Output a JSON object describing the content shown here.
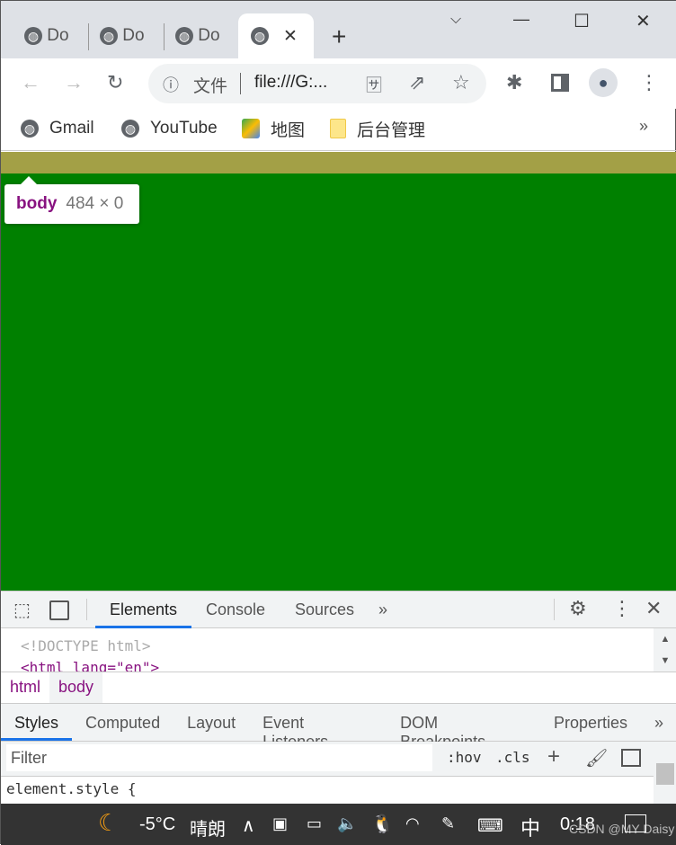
{
  "tabs": [
    {
      "title": "Do"
    },
    {
      "title": "Do"
    },
    {
      "title": "Do"
    },
    {
      "title": "",
      "active": true
    }
  ],
  "window": {
    "tab_search": "⌵",
    "minimize": "—",
    "maximize": "☐",
    "close": "✕",
    "new_tab": "+"
  },
  "address": {
    "security_label": "文件",
    "url": "file:///G:..."
  },
  "bookmarks": [
    {
      "label": "Gmail",
      "icon": "globe-icon"
    },
    {
      "label": "YouTube",
      "icon": "globe-icon"
    },
    {
      "label": "地图",
      "icon": "maps-icon"
    },
    {
      "label": "后台管理",
      "icon": "folder-icon"
    }
  ],
  "bookmarks_more": "»",
  "tooltip": {
    "tag": "body",
    "size": "484 × 0"
  },
  "colors": {
    "page": "#008000",
    "margin": "#a3a046",
    "tag": "#881280",
    "accent": "#1a73e8"
  },
  "devtools": {
    "tabs": [
      "Elements",
      "Console",
      "Sources"
    ],
    "more": "»",
    "active_tab": "Elements",
    "code": [
      "<!DOCTYPE html>",
      "<html lang=\"en\">"
    ],
    "breadcrumbs": [
      "html",
      "body"
    ],
    "style_tabs": [
      "Styles",
      "Computed",
      "Layout",
      "Event Listeners",
      "DOM Breakpoints",
      "Properties"
    ],
    "style_more": "»",
    "filter_placeholder": "Filter",
    "hov": ":hov",
    "cls": ".cls",
    "add": "+",
    "element_style": "element.style {"
  },
  "taskbar": {
    "temp": "-5°C",
    "weather": "晴朗",
    "ime": "中",
    "time": "0:18",
    "watermark": "CSDN @MY Daisy"
  }
}
